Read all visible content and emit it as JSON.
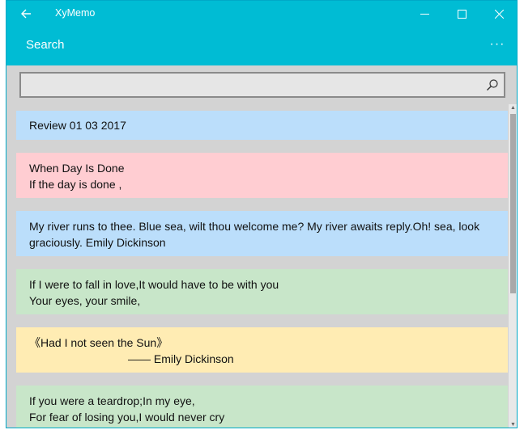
{
  "titlebar": {
    "app_title": "XyMemo"
  },
  "header": {
    "title": "Search",
    "more_label": "···"
  },
  "search": {
    "value": "",
    "placeholder": ""
  },
  "memos": [
    {
      "lines": [
        "Review 01 03 2017"
      ],
      "color": "#bbdefb"
    },
    {
      "lines": [
        "When Day Is Done",
        "If the day is done ,"
      ],
      "color": "#ffcdd2"
    },
    {
      "lines": [
        "My river runs to thee. Blue sea, wilt thou welcome me? My river awaits reply.Oh! sea, look",
        "graciously. Emily Dickinson"
      ],
      "color": "#bbdefb"
    },
    {
      "lines": [
        "If I were to fall in love,It would have to be with you",
        "Your eyes, your smile,"
      ],
      "color": "#c8e6c9"
    },
    {
      "lines": [
        "《Had I not seen the Sun》",
        "—— Emily Dickinson"
      ],
      "color": "#ffecb3"
    },
    {
      "lines": [
        "If you were a teardrop;In my eye,",
        "For fear of losing you,I would never cry"
      ],
      "color": "#c8e6c9"
    }
  ],
  "colors": {
    "accent": "#00bcd4",
    "background": "#d3d3d3"
  }
}
